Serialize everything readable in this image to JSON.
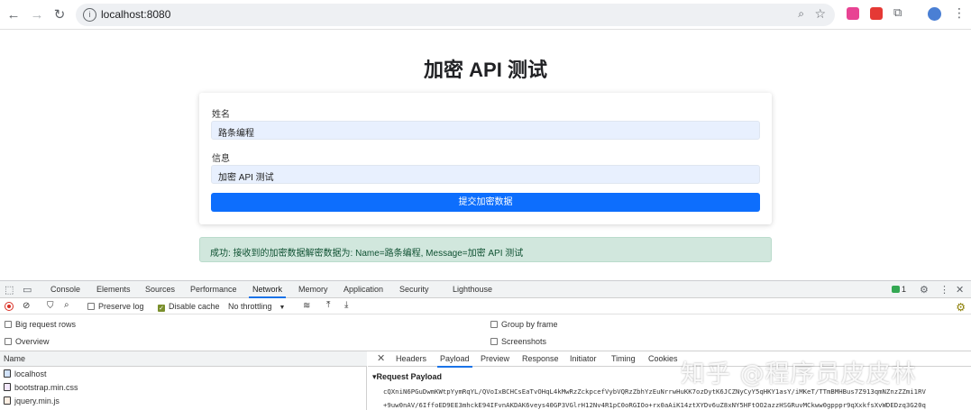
{
  "browser": {
    "url": "localhost:8080",
    "back_icon": "arrow-left-icon",
    "forward_icon": "arrow-right-icon",
    "reload_icon": "reload-icon",
    "site_info_icon": "info-icon",
    "zoom_icon": "zoom-icon",
    "bookmark_icon": "star-icon",
    "extensions_icon": "puzzle-icon",
    "menu_icon": "kebab-icon"
  },
  "page": {
    "title": "加密 API 测试",
    "form": {
      "name_label": "姓名",
      "name_value": "路条编程",
      "info_label": "信息",
      "info_value": "加密 API 测试",
      "submit_label": "提交加密数据"
    },
    "alert_text": "成功: 接收到的加密数据解密数据为: Name=路条编程, Message=加密 API 测试"
  },
  "devtools": {
    "tabs": [
      "Console",
      "Elements",
      "Sources",
      "Performance",
      "Network",
      "Memory",
      "Application",
      "Security",
      "Lighthouse"
    ],
    "active_tab": "Network",
    "badge_count": "1",
    "toolbar": {
      "preserve_log": "Preserve log",
      "disable_cache": "Disable cache",
      "throttling": "No throttling"
    },
    "options": {
      "big_request_rows": "Big request rows",
      "overview": "Overview",
      "group_by_frame": "Group by frame",
      "screenshots": "Screenshots"
    },
    "name_header": "Name",
    "files": [
      "localhost",
      "bootstrap.min.css",
      "jquery.min.js"
    ],
    "detail_tabs": [
      "Headers",
      "Payload",
      "Preview",
      "Response",
      "Initiator",
      "Timing",
      "Cookies"
    ],
    "active_detail_tab": "Payload",
    "payload_title": "▾Request Payload",
    "payload_lines": [
      "cQXniN6PGuDwmKWtpYymRqYL/QVoIxBCHCsEaTvOHqL4kMwRzZckpcefVybVQRzZbhYzEuNrrwHuKK7ozDytK6JCZNyCyY5qHKY1asY/iMKeT/TTmBMHBus7Z913qmNZnzZZmi1RV",
      "+9uw0nAV/6IffoED9EE3mhckE94IFvnAKDAK6veys40GP3VGlrH12Nv4R1pC0oRGIOo+rx0aAiK14ztXYDv6uZ8xNY5HFtOO2azzHSGRuvMCkww0gpppr9qXxkfsXvWDEDzq3G20q"
    ]
  },
  "watermark": "知乎 @程序员皮皮林"
}
